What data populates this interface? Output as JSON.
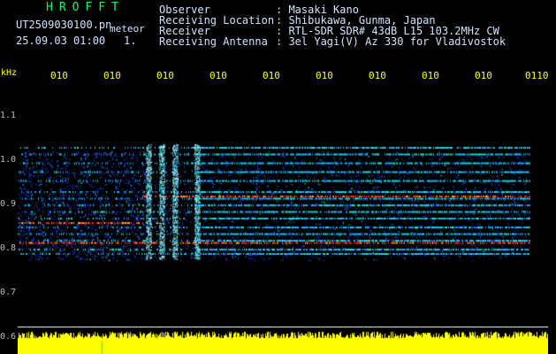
{
  "header": {
    "app_title": "HROFFT",
    "file_name": "UT2509030100.pn",
    "file_tag": "meteor",
    "date_time": "25.09.03 01:00",
    "page": "1."
  },
  "info": [
    {
      "key": "Observer",
      "value": ": Masaki Kano"
    },
    {
      "key": "Receiving Location",
      "value": ": Shibukawa, Gunma, Japan"
    },
    {
      "key": "Receiver",
      "value": ": RTL-SDR SDR# 43dB L15 103.2MHz CW"
    },
    {
      "key": "Receiving Antenna",
      "value": ": 3el Yagi(V) Az 330 for Vladivostok"
    }
  ],
  "axis": {
    "unit": "kHz",
    "time_ticks": [
      "010",
      "010",
      "010",
      "010",
      "010",
      "010",
      "010",
      "010",
      "010",
      "0110"
    ],
    "freq_ticks": [
      "1.1",
      "1.0",
      "0.9",
      "0.8",
      "0.7",
      "0.6"
    ]
  },
  "colors": {
    "background": "#000000",
    "signal_low": "#1a3cff",
    "signal_mid": "#00e0ff",
    "signal_high": "#ff2020",
    "level_bar": "#ffff00",
    "label_text": "#ffff00"
  }
}
